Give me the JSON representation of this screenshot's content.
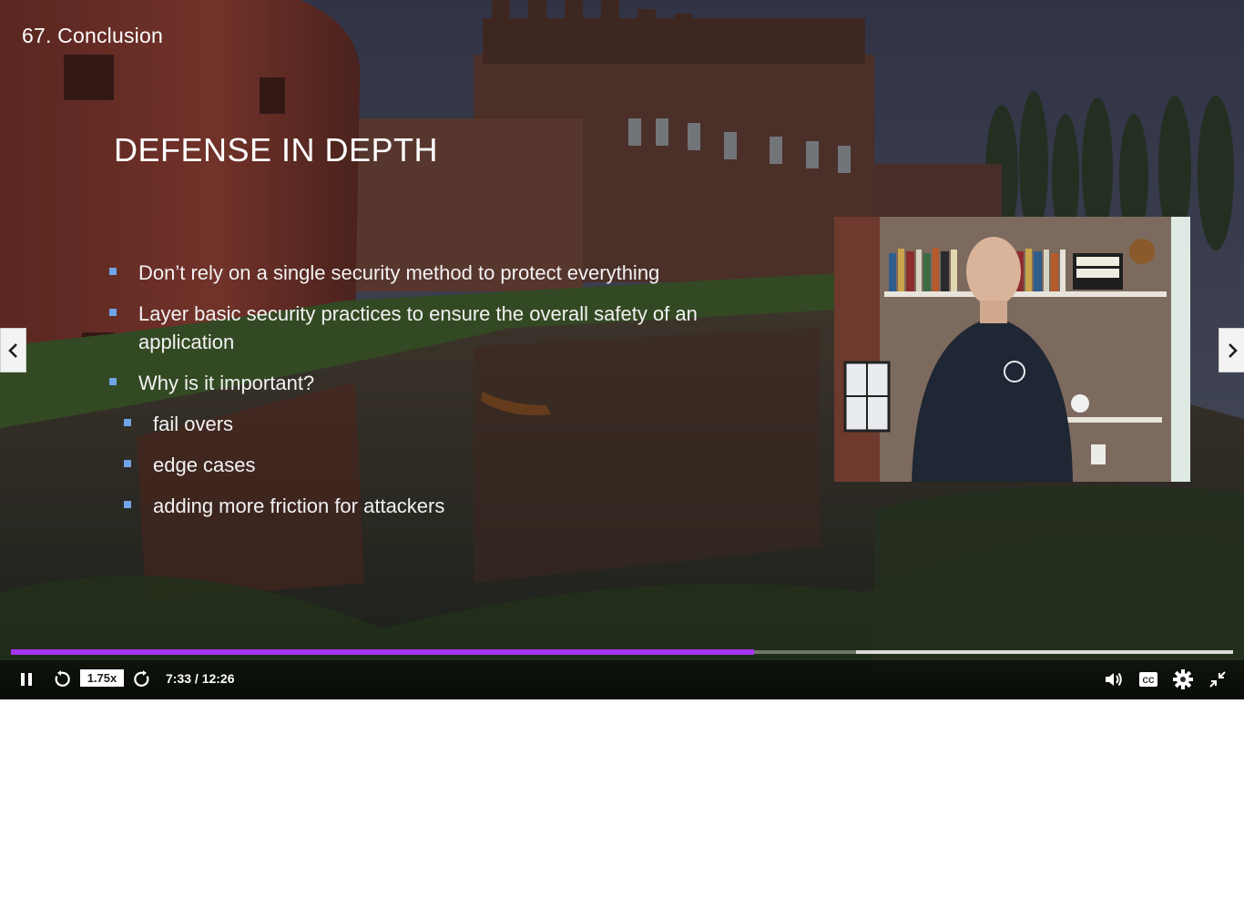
{
  "lecture": {
    "title": "67. Conclusion"
  },
  "slide": {
    "heading": "DEFENSE IN DEPTH",
    "bullets": [
      "Don’t rely on a single security method to protect everything",
      "Layer basic security practices to ensure the overall safety of an application",
      "Why is it important?"
    ],
    "sub_bullets": [
      "fail overs",
      "edge cases",
      "adding more friction for attackers"
    ]
  },
  "player": {
    "speed": "1.75x",
    "time": "7:33 / 12:26",
    "progress_fraction": 0.608,
    "buffered_fraction": 0.692,
    "accent": "#a435f0",
    "bullet_color": "#6fa4e8",
    "cc_label": "CC"
  },
  "icons": [
    "pause-icon",
    "rewind-icon",
    "forward-icon",
    "volume-icon",
    "captions-icon",
    "settings-icon",
    "exit-fullscreen-icon",
    "chevron-left-icon",
    "chevron-right-icon"
  ]
}
